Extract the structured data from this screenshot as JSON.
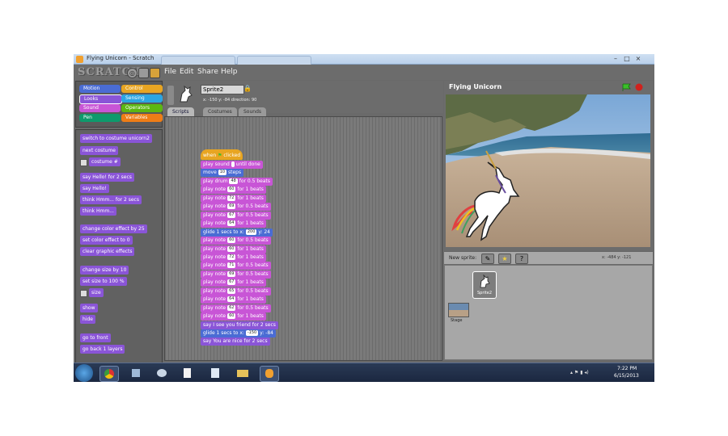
{
  "window": {
    "title": "Flying Unicorn - Scratch"
  },
  "menubar": {
    "logo": "SCRATCH",
    "items": [
      "File",
      "Edit",
      "Share",
      "Help"
    ]
  },
  "categories": [
    {
      "label": "Motion",
      "color": "#4a6cd4"
    },
    {
      "label": "Control",
      "color": "#e8a522"
    },
    {
      "label": "Looks",
      "color": "#8a55d7"
    },
    {
      "label": "Sensing",
      "color": "#2ca5e2"
    },
    {
      "label": "Sound",
      "color": "#c855d6"
    },
    {
      "label": "Operators",
      "color": "#5cb712"
    },
    {
      "label": "Pen",
      "color": "#0e9a6c"
    },
    {
      "label": "Variables",
      "color": "#ee7d16"
    }
  ],
  "palette": [
    "switch to costume unicorn2",
    "next costume",
    "costume #",
    "say Hello! for 2 secs",
    "say Hello!",
    "think Hmm... for 2 secs",
    "think Hmm...",
    "change color effect by 25",
    "set color effect to 0",
    "clear graphic effects",
    "change size by 10",
    "set size to 100 %",
    "size",
    "show",
    "hide",
    "go to front",
    "go back 1 layers"
  ],
  "sprite": {
    "name": "Sprite2",
    "info": "x: -150  y: -84   direction: 90"
  },
  "tabs": [
    "Scripts",
    "Costumes",
    "Sounds"
  ],
  "script": [
    {
      "text": "when",
      "tail": "clicked",
      "kind": "ctl"
    },
    {
      "text": "play sound",
      "slot": "",
      "tail": "until done",
      "kind": "snd"
    },
    {
      "text": "move",
      "slot": "10",
      "tail": "steps",
      "kind": "mot"
    },
    {
      "text": "play drum",
      "slot": "48",
      "tail": "for 0.5 beats",
      "kind": "snd"
    },
    {
      "text": "play note",
      "slot": "60",
      "tail": "for 1 beats",
      "kind": "snd"
    },
    {
      "text": "play note",
      "slot": "72",
      "tail": "for 1 beats",
      "kind": "snd"
    },
    {
      "text": "play note",
      "slot": "69",
      "tail": "for 0.5 beats",
      "kind": "snd"
    },
    {
      "text": "play note",
      "slot": "67",
      "tail": "for 0.5 beats",
      "kind": "snd"
    },
    {
      "text": "play note",
      "slot": "64",
      "tail": "for 1 beats",
      "kind": "snd"
    },
    {
      "text": "glide 1 secs to x:",
      "slot": "200",
      "tail": "y: 24",
      "kind": "mot"
    },
    {
      "text": "play note",
      "slot": "60",
      "tail": "for 0.5 beats",
      "kind": "snd"
    },
    {
      "text": "play note",
      "slot": "60",
      "tail": "for 1 beats",
      "kind": "snd"
    },
    {
      "text": "play note",
      "slot": "72",
      "tail": "for 1 beats",
      "kind": "snd"
    },
    {
      "text": "play note",
      "slot": "71",
      "tail": "for 0.5 beats",
      "kind": "snd"
    },
    {
      "text": "play note",
      "slot": "69",
      "tail": "for 0.5 beats",
      "kind": "snd"
    },
    {
      "text": "play note",
      "slot": "67",
      "tail": "for 1 beats",
      "kind": "snd"
    },
    {
      "text": "play note",
      "slot": "65",
      "tail": "for 0.5 beats",
      "kind": "snd"
    },
    {
      "text": "play note",
      "slot": "64",
      "tail": "for 1 beats",
      "kind": "snd"
    },
    {
      "text": "play note",
      "slot": "62",
      "tail": "for 0.5 beats",
      "kind": "snd"
    },
    {
      "text": "play note",
      "slot": "60",
      "tail": "for 1 beats",
      "kind": "snd"
    },
    {
      "text": "say I see you friend for 2 secs",
      "kind": "look"
    },
    {
      "text": "glide 1 secs to x:",
      "slot": "-150",
      "tail": "y: -84",
      "kind": "mot"
    },
    {
      "text": "say You are nice for 2 secs",
      "kind": "look"
    }
  ],
  "stage": {
    "title": "Flying Unicorn",
    "coords": "x: -484  y: -121"
  },
  "sprites_panel": {
    "new_sprite_label": "New sprite:",
    "sprite_thumb_label": "Sprite2",
    "stage_label": "Stage"
  },
  "taskbar": {
    "time": "7:22 PM",
    "date": "6/15/2013"
  }
}
